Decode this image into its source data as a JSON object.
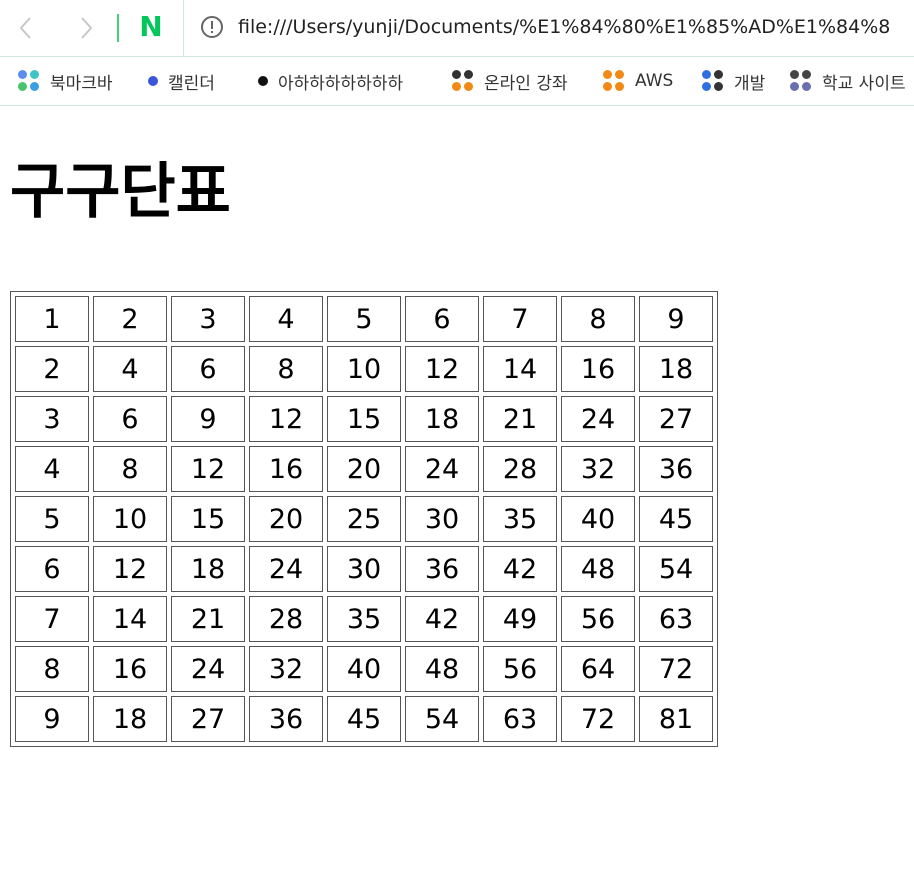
{
  "browser": {
    "url": "file:///Users/yunji/Documents/%E1%84%80%E1%85%AD%E1%84%8",
    "naver_label": "N"
  },
  "bookmarks": [
    {
      "label": "북마크바",
      "icon": "apps-grid-icon",
      "colors": [
        "#5b8def",
        "#3ec4c4",
        "#49c46d",
        "#38a0e0"
      ]
    },
    {
      "label": "캘린더",
      "icon": "dot-icon",
      "colors": [
        "#3b55d9"
      ]
    },
    {
      "label": "아하하하하하하하",
      "icon": "dot-icon",
      "colors": [
        "#111111"
      ]
    },
    {
      "label": "온라인 강좌",
      "icon": "apps-grid-icon",
      "colors": [
        "#333333",
        "#333333",
        "#f08a14",
        "#f08a14"
      ]
    },
    {
      "label": "AWS",
      "icon": "apps-grid-icon",
      "colors": [
        "#f08a14",
        "#f08a14",
        "#f08a14",
        "#f08a14"
      ]
    },
    {
      "label": "개발",
      "icon": "apps-grid-icon",
      "colors": [
        "#2f6fe0",
        "#333333",
        "#2f6fe0",
        "#333333"
      ]
    },
    {
      "label": "학교 사이트",
      "icon": "apps-grid-icon",
      "colors": [
        "#444444",
        "#444444",
        "#6a6fb0",
        "#6a6fb0"
      ]
    }
  ],
  "page": {
    "title": "구구단표"
  },
  "table": {
    "rows": [
      [
        "1",
        "2",
        "3",
        "4",
        "5",
        "6",
        "7",
        "8",
        "9"
      ],
      [
        "2",
        "4",
        "6",
        "8",
        "10",
        "12",
        "14",
        "16",
        "18"
      ],
      [
        "3",
        "6",
        "9",
        "12",
        "15",
        "18",
        "21",
        "24",
        "27"
      ],
      [
        "4",
        "8",
        "12",
        "16",
        "20",
        "24",
        "28",
        "32",
        "36"
      ],
      [
        "5",
        "10",
        "15",
        "20",
        "25",
        "30",
        "35",
        "40",
        "45"
      ],
      [
        "6",
        "12",
        "18",
        "24",
        "30",
        "36",
        "42",
        "48",
        "54"
      ],
      [
        "7",
        "14",
        "21",
        "28",
        "35",
        "42",
        "49",
        "56",
        "63"
      ],
      [
        "8",
        "16",
        "24",
        "32",
        "40",
        "48",
        "56",
        "64",
        "72"
      ],
      [
        "9",
        "18",
        "27",
        "36",
        "45",
        "54",
        "63",
        "72",
        "81"
      ]
    ]
  }
}
